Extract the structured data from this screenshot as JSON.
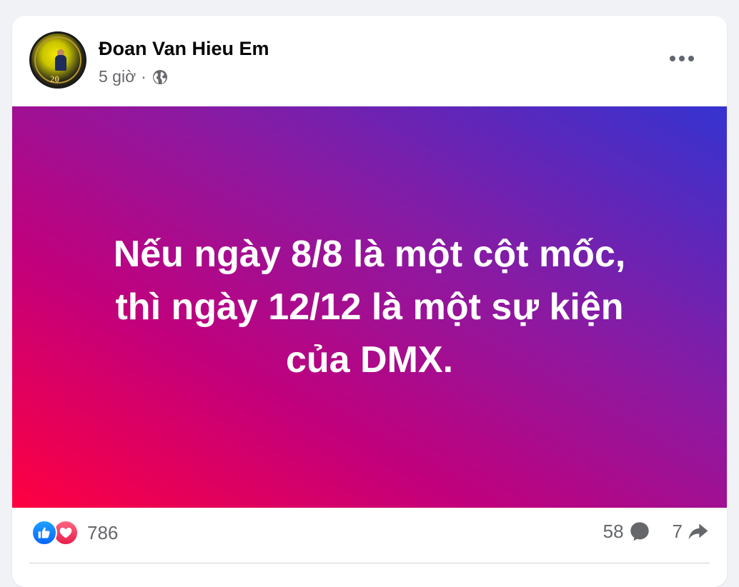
{
  "post": {
    "author": "Đoan Van Hieu Em",
    "time": "5 giờ",
    "separator": "·",
    "privacy_icon": "globe-icon",
    "text": "Nếu ngày 8/8 là một cột mốc,\nthì ngày 12/12 là một sự kiện\ncủa DMX.",
    "background_gradient": [
      "#ff0040",
      "#c2007c",
      "#8a1aa2",
      "#3533d0"
    ]
  },
  "avatar": {
    "badge_text": "20"
  },
  "stats": {
    "reaction_icons": [
      "like-icon",
      "love-icon"
    ],
    "reactions_count": "786",
    "comments_count": "58",
    "shares_count": "7"
  },
  "colors": {
    "like": "#0866ff",
    "love": "#e61e4d",
    "muted_text": "#65676b"
  }
}
